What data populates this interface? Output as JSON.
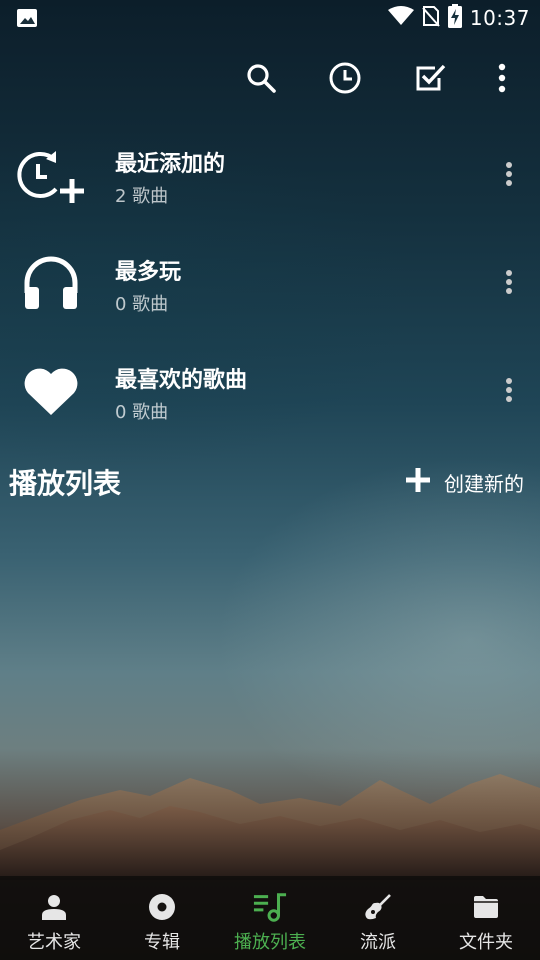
{
  "status_bar": {
    "time": "10:37",
    "icons": [
      "image-icon",
      "wifi-icon",
      "no-sim-icon",
      "battery-charging-icon"
    ]
  },
  "toolbar": {
    "actions": [
      "search-icon",
      "history-icon",
      "select-icon",
      "more-vertical-icon"
    ]
  },
  "playlists_auto": [
    {
      "icon": "recently-added-icon",
      "title": "最近添加的",
      "subtitle": "2 歌曲"
    },
    {
      "icon": "headphones-icon",
      "title": "最多玩",
      "subtitle": "0 歌曲"
    },
    {
      "icon": "heart-icon",
      "title": "最喜欢的歌曲",
      "subtitle": "0 歌曲"
    }
  ],
  "section": {
    "title": "播放列表",
    "create_label": "创建新的"
  },
  "bottom_nav": {
    "active_color": "#4caf50",
    "items": [
      {
        "icon": "person-icon",
        "label": "艺术家"
      },
      {
        "icon": "album-icon",
        "label": "专辑"
      },
      {
        "icon": "playlist-icon",
        "label": "播放列表",
        "active": true
      },
      {
        "icon": "guitar-icon",
        "label": "流派"
      },
      {
        "icon": "folder-icon",
        "label": "文件夹"
      }
    ]
  }
}
